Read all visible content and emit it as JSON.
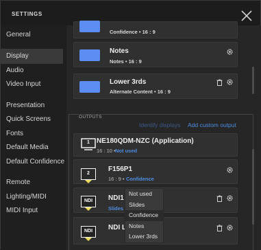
{
  "window": {
    "title": "SETTINGS"
  },
  "sidebar": {
    "items": [
      {
        "label": "General"
      },
      {
        "label": "Display"
      },
      {
        "label": "Audio"
      },
      {
        "label": "Video Input"
      },
      {
        "label": "Presentation"
      },
      {
        "label": "Quick Screens"
      },
      {
        "label": "Fonts"
      },
      {
        "label": "Default Media"
      },
      {
        "label": "Default Confidence"
      },
      {
        "label": "Remote"
      },
      {
        "label": "Lighting/MIDI"
      },
      {
        "label": "MIDI Input"
      }
    ],
    "active": "Display"
  },
  "screens": [
    {
      "title": "",
      "subtitle": "Confidence • 16 : 9"
    },
    {
      "title": "Notes",
      "subtitle": "Notes • 16 : 9"
    },
    {
      "title": "Lower 3rds",
      "subtitle": "Alternate Content • 16 : 9"
    }
  ],
  "outputs_section": {
    "label": "OUTPUTS",
    "identify_label": "Identify displays",
    "add_label": "Add custom output"
  },
  "outputs": [
    {
      "badge": "1",
      "title": "NE180QDM-NZC (Application)",
      "aspect": "16 : 10 •",
      "type": "Not used"
    },
    {
      "badge": "2",
      "title": "F156P1",
      "aspect": "16 : 9 •",
      "type": "Confidence"
    },
    {
      "badge": "NDI",
      "title": "NDI1",
      "type": "Slides"
    },
    {
      "badge": "NDI",
      "title": "NDI L"
    }
  ],
  "dropdown": {
    "options": [
      "Not used",
      "Slides",
      "Confidence",
      "Notes",
      "Lower 3rds"
    ],
    "selected": "Confidence"
  },
  "colors": {
    "accent": "#5b8df2",
    "link": "#4d8de0",
    "badge_yellow": "#e8d95a"
  }
}
